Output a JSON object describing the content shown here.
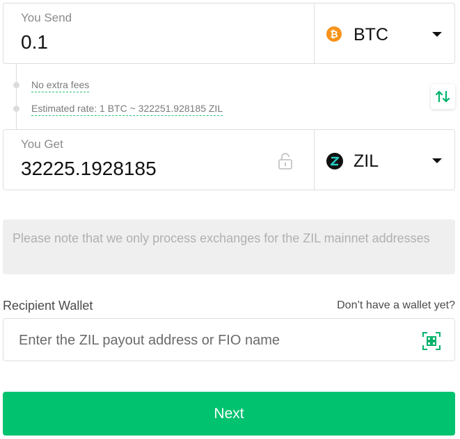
{
  "send": {
    "label": "You Send",
    "value": "0.1",
    "currency": "BTC",
    "icon": "bitcoin-icon",
    "icon_color": "#f7931a"
  },
  "info": {
    "fees": "No extra fees",
    "rate": "Estimated rate: 1 BTC ~ 322251.928185 ZIL"
  },
  "swap": {
    "icon": "swap-arrows-icon",
    "color": "#00b36b"
  },
  "get": {
    "label": "You Get",
    "value": "32225.1928185",
    "currency": "ZIL",
    "icon": "zilliqa-icon",
    "icon_color": "#29ccc4"
  },
  "notice": {
    "text": "Please note that we only process exchanges for the ZIL mainnet addresses"
  },
  "recipient": {
    "label": "Recipient Wallet",
    "help_link": "Don’t have a wallet yet?",
    "placeholder": "Enter the ZIL payout address or FIO name"
  },
  "next": {
    "label": "Next",
    "color": "#00c26f"
  }
}
